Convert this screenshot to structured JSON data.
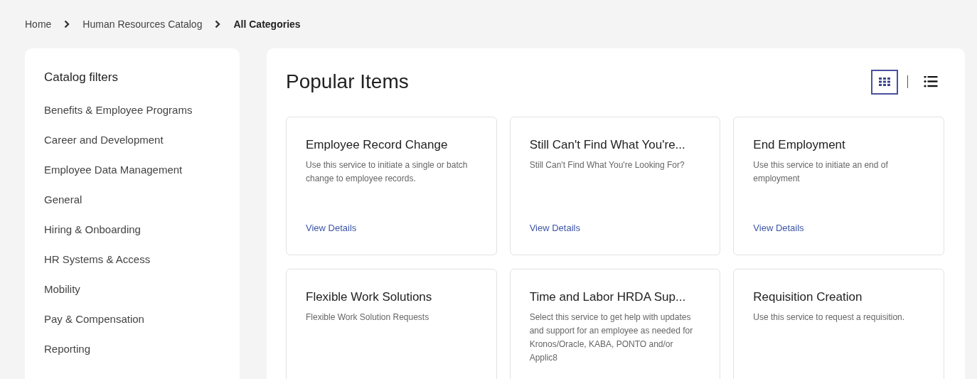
{
  "breadcrumb": [
    {
      "label": "Home",
      "current": false
    },
    {
      "label": "Human Resources Catalog",
      "current": false
    },
    {
      "label": "All Categories",
      "current": true
    }
  ],
  "sidebar": {
    "title": "Catalog filters",
    "items": [
      "Benefits & Employee Programs",
      "Career and Development",
      "Employee Data Management",
      "General",
      "Hiring & Onboarding",
      "HR Systems & Access",
      "Mobility",
      "Pay & Compensation",
      "Reporting"
    ]
  },
  "main": {
    "title": "Popular Items",
    "views": [
      {
        "kind": "grid",
        "selected": true
      },
      {
        "kind": "list",
        "selected": false
      }
    ],
    "cards": [
      {
        "title": "Employee Record Change",
        "description": "Use this service to initiate a single or batch change to employee records.",
        "link": "View Details"
      },
      {
        "title": "Still Can't Find What You're...",
        "description": "Still Can't Find What You're Looking For?",
        "link": "View Details"
      },
      {
        "title": "End Employment",
        "description": "Use this service to initiate an end of employment",
        "link": "View Details"
      },
      {
        "title": "Flexible Work Solutions",
        "description": "Flexible Work Solution Requests"
      },
      {
        "title": "Time and Labor HRDA Sup...",
        "description": "Select this service to get help with updates and support for an employee as needed for Kronos/Oracle, KABA, PONTO and/or Applic8"
      },
      {
        "title": "Requisition Creation",
        "description": "Use this service to request a requisition."
      }
    ]
  }
}
